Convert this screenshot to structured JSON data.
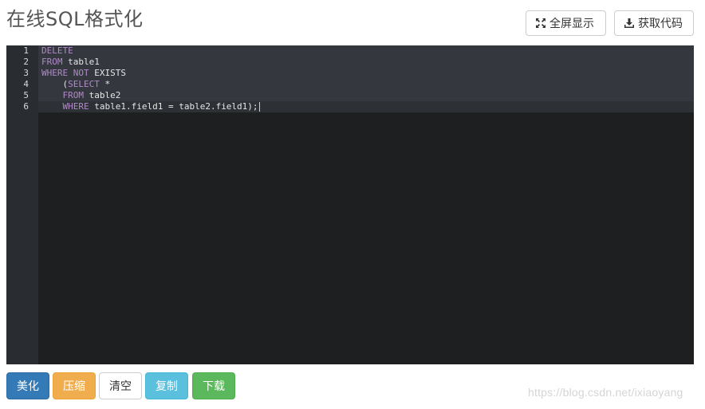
{
  "header": {
    "title": "在线SQL格式化",
    "fullscreen_label": "全屏显示",
    "getcode_label": "获取代码"
  },
  "editor": {
    "lines": [
      {
        "num": "1",
        "tokens": [
          {
            "t": "DELETE",
            "kw": true
          }
        ]
      },
      {
        "num": "2",
        "tokens": [
          {
            "t": "FROM",
            "kw": true
          },
          {
            "t": " table1",
            "kw": false
          }
        ]
      },
      {
        "num": "3",
        "tokens": [
          {
            "t": "WHERE",
            "kw": true
          },
          {
            "t": " ",
            "kw": false
          },
          {
            "t": "NOT",
            "kw": true
          },
          {
            "t": " EXISTS",
            "kw": false
          }
        ]
      },
      {
        "num": "4",
        "tokens": [
          {
            "t": "    (",
            "kw": false
          },
          {
            "t": "SELECT",
            "kw": true
          },
          {
            "t": " *",
            "kw": false
          }
        ]
      },
      {
        "num": "5",
        "tokens": [
          {
            "t": "    ",
            "kw": false
          },
          {
            "t": "FROM",
            "kw": true
          },
          {
            "t": " table2",
            "kw": false
          }
        ]
      },
      {
        "num": "6",
        "tokens": [
          {
            "t": "    ",
            "kw": false
          },
          {
            "t": "WHERE",
            "kw": true
          },
          {
            "t": " table1.field1 = table2.field1);",
            "kw": false
          }
        ]
      }
    ],
    "colors": {
      "background": "#1e1f20",
      "keyword": "#b08ac8",
      "text": "#e6e6e6"
    }
  },
  "actions": {
    "beautify": "美化",
    "compress": "压缩",
    "clear": "清空",
    "copy": "复制",
    "download": "下载"
  },
  "watermark": "https://blog.csdn.net/ixiaoyang"
}
